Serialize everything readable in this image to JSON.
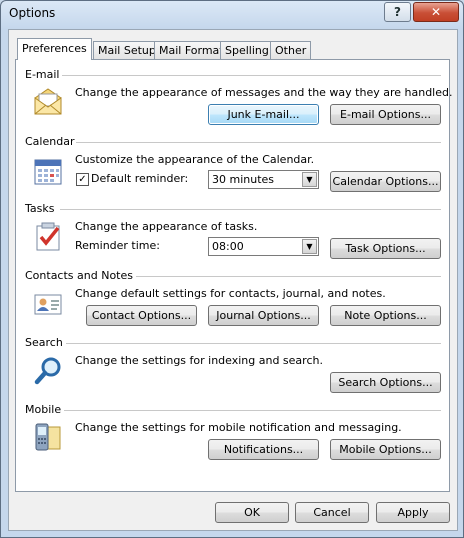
{
  "window": {
    "title": "Options"
  },
  "titlebar": {
    "help_label": "?",
    "close_label": "✕"
  },
  "tabs": [
    {
      "label": "Preferences",
      "active": true
    },
    {
      "label": "Mail Setup"
    },
    {
      "label": "Mail Format"
    },
    {
      "label": "Spelling"
    },
    {
      "label": "Other"
    }
  ],
  "email": {
    "title": "E-mail",
    "description": "Change the appearance of messages and the way they are handled.",
    "junk_button": "Junk E-mail...",
    "options_button": "E-mail Options..."
  },
  "calendar": {
    "title": "Calendar",
    "description": "Customize the appearance of the Calendar.",
    "reminder_label": "Default reminder:",
    "reminder_checked": true,
    "reminder_value": "30 minutes",
    "options_button": "Calendar Options..."
  },
  "tasks": {
    "title": "Tasks",
    "description": "Change the appearance of tasks.",
    "reminder_label": "Reminder time:",
    "reminder_value": "08:00",
    "options_button": "Task Options..."
  },
  "contacts": {
    "title": "Contacts and Notes",
    "description": "Change default settings for contacts, journal, and notes.",
    "contact_button": "Contact Options...",
    "journal_button": "Journal Options...",
    "note_button": "Note Options..."
  },
  "search": {
    "title": "Search",
    "description": "Change the settings for indexing and search.",
    "options_button": "Search Options..."
  },
  "mobile": {
    "title": "Mobile",
    "description": "Change the settings for mobile notification and messaging.",
    "notifications_button": "Notifications...",
    "options_button": "Mobile Options..."
  },
  "footer": {
    "ok": "OK",
    "cancel": "Cancel",
    "apply": "Apply"
  }
}
